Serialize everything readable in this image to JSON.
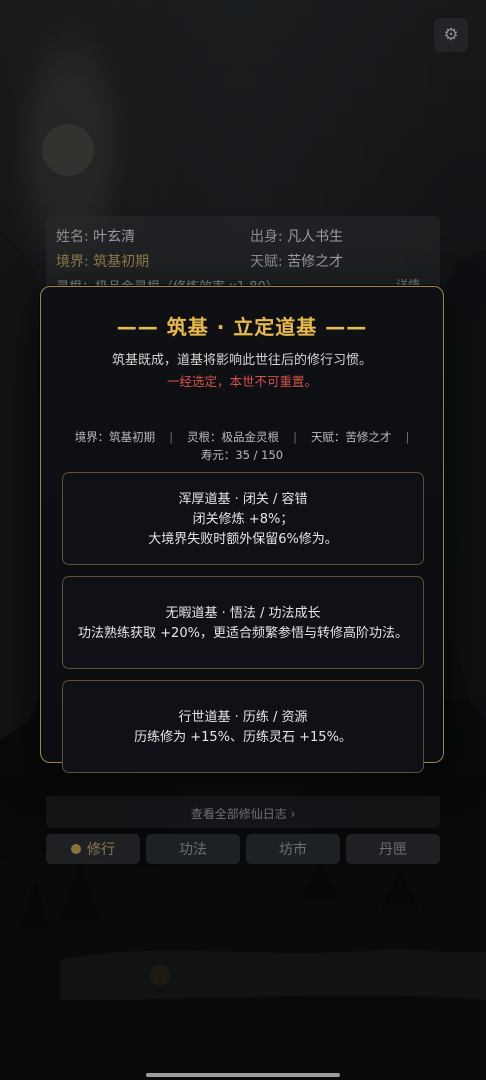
{
  "settings": {
    "icon": "gear-icon"
  },
  "status": {
    "name_label": "姓名:",
    "name_value": "叶玄清",
    "origin_label": "出身:",
    "origin_value": "凡人书生",
    "realm_label": "境界:",
    "realm_value": "筑基初期",
    "talent_label": "天赋:",
    "talent_value": "苦修之才",
    "root_partial": "灵根：极品金灵根（修炼效率 x1.80）",
    "detail_link": "详情"
  },
  "modal": {
    "title": "—— 筑基 · 立定道基 ——",
    "desc": "筑基既成，道基将影响此世往后的修行习惯。",
    "warning": "一经选定，本世不可重置。",
    "info": {
      "realm": "境界：筑基初期",
      "root": "灵根：极品金灵根",
      "talent": "天赋：苦修之才",
      "separator": "|",
      "lifespan": "寿元：35 / 150"
    },
    "options": [
      {
        "title": "浑厚道基 · 闭关 / 容错",
        "line1": "闭关修炼 +8%；",
        "line2": "大境界失败时额外保留6%修为。"
      },
      {
        "title": "无暇道基 · 悟法 / 功法成长",
        "line1": "功法熟练获取 +20%，更适合频繁参悟与转修高阶功法。",
        "line2": ""
      },
      {
        "title": "行世道基 · 历练 / 资源",
        "line1": "历练修为 +15%、历练灵石 +15%。",
        "line2": ""
      }
    ]
  },
  "log_link": "查看全部修仙日志 ›",
  "nav": {
    "items": [
      {
        "label": "修行",
        "active": true
      },
      {
        "label": "功法",
        "active": false
      },
      {
        "label": "坊市",
        "active": false
      },
      {
        "label": "丹匣",
        "active": false
      }
    ]
  },
  "colors": {
    "accent": "#e8b94f",
    "warning": "#d4524a",
    "border": "#a08550"
  }
}
